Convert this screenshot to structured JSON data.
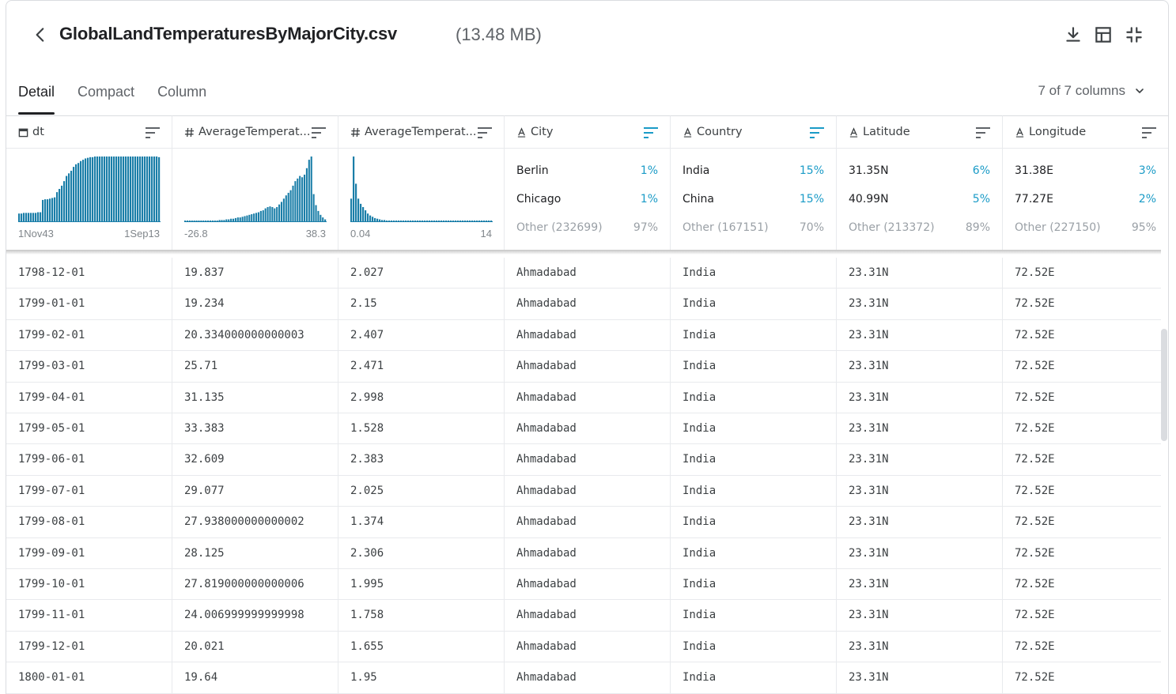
{
  "header": {
    "title": "GlobalLandTemperaturesByMajorCity.csv",
    "size": "(13.48 MB)",
    "icons": [
      "back-arrow-icon",
      "download-icon",
      "table-view-icon",
      "collapse-icon"
    ]
  },
  "tabs": [
    {
      "label": "Detail",
      "active": true
    },
    {
      "label": "Compact",
      "active": false
    },
    {
      "label": "Column",
      "active": false
    }
  ],
  "column_count": "7 of 7 columns",
  "columns": [
    {
      "type_icon": "calendar-icon",
      "type_glyph": "",
      "name": "dt"
    },
    {
      "type_icon": "numeric-icon",
      "type_glyph": "#",
      "name": "AverageTemperat..."
    },
    {
      "type_icon": "numeric-icon",
      "type_glyph": "#",
      "name": "AverageTemperat..."
    },
    {
      "type_icon": "string-icon",
      "type_glyph": "A",
      "name": "City"
    },
    {
      "type_icon": "string-icon",
      "type_glyph": "A",
      "name": "Country"
    },
    {
      "type_icon": "string-icon",
      "type_glyph": "A",
      "name": "Latitude"
    },
    {
      "type_icon": "string-icon",
      "type_glyph": "A",
      "name": "Longitude"
    }
  ],
  "histograms": [
    {
      "min": "1Nov43",
      "max": "1Sep13",
      "color": "#1a7ea8",
      "bars": [
        0.12,
        0.12,
        0.13,
        0.13,
        0.13,
        0.13,
        0.13,
        0.13,
        0.14,
        0.14,
        0.33,
        0.34,
        0.34,
        0.35,
        0.36,
        0.37,
        0.45,
        0.5,
        0.55,
        0.62,
        0.7,
        0.74,
        0.78,
        0.84,
        0.88,
        0.9,
        0.93,
        0.95,
        0.97,
        0.98,
        0.99,
        0.99,
        1.0,
        1.0,
        1.0,
        1.0,
        1.0,
        1.0,
        1.0,
        1.0,
        1.0,
        1.0,
        1.0,
        1.0,
        1.0,
        1.0,
        1.0,
        1.0,
        1.0,
        1.0,
        1.0,
        1.0,
        1.0,
        1.0,
        1.0,
        1.0,
        1.0,
        1.0,
        1.0,
        0.99
      ]
    },
    {
      "min": "-26.8",
      "max": "38.3",
      "color": "#1a7ea8",
      "bars": [
        0.01,
        0.01,
        0.01,
        0.01,
        0.01,
        0.01,
        0.01,
        0.01,
        0.01,
        0.01,
        0.01,
        0.01,
        0.01,
        0.01,
        0.01,
        0.02,
        0.02,
        0.02,
        0.03,
        0.03,
        0.04,
        0.04,
        0.05,
        0.06,
        0.06,
        0.07,
        0.08,
        0.09,
        0.1,
        0.11,
        0.12,
        0.13,
        0.14,
        0.16,
        0.17,
        0.2,
        0.22,
        0.23,
        0.22,
        0.2,
        0.22,
        0.26,
        0.3,
        0.35,
        0.4,
        0.44,
        0.48,
        0.55,
        0.62,
        0.66,
        0.7,
        0.68,
        0.72,
        0.82,
        0.95,
        1.0,
        0.42,
        0.25,
        0.16,
        0.1,
        0.06,
        0.03
      ]
    },
    {
      "min": "0.04",
      "max": "14",
      "color": "#1a7ea8",
      "bars": [
        0.35,
        1.0,
        0.58,
        0.35,
        0.27,
        0.22,
        0.17,
        0.12,
        0.09,
        0.07,
        0.05,
        0.04,
        0.03,
        0.02,
        0.02,
        0.01,
        0.01,
        0.01,
        0.01,
        0.01,
        0.01,
        0.01,
        0.01,
        0.01,
        0.01,
        0.01,
        0.01,
        0.01,
        0.01,
        0.01,
        0.01,
        0.01,
        0.01,
        0.01,
        0.01,
        0.01,
        0.01,
        0.01,
        0.01,
        0.01,
        0.01,
        0.01,
        0.01,
        0.01,
        0.01,
        0.01,
        0.01,
        0.01,
        0.01,
        0.01,
        0.01,
        0.01,
        0.01,
        0.01,
        0.01,
        0.01,
        0.01,
        0.01,
        0.01,
        0.01
      ]
    }
  ],
  "freq": [
    {
      "rows": [
        {
          "label": "Berlin",
          "pct": "1%"
        },
        {
          "label": "Chicago",
          "pct": "1%"
        },
        {
          "label": "Other (232699)",
          "pct": "97%"
        }
      ]
    },
    {
      "rows": [
        {
          "label": "India",
          "pct": "15%"
        },
        {
          "label": "China",
          "pct": "15%"
        },
        {
          "label": "Other (167151)",
          "pct": "70%"
        }
      ]
    },
    {
      "rows": [
        {
          "label": "31.35N",
          "pct": "6%"
        },
        {
          "label": "40.99N",
          "pct": "5%"
        },
        {
          "label": "Other (213372)",
          "pct": "89%"
        }
      ]
    },
    {
      "rows": [
        {
          "label": "31.38E",
          "pct": "3%"
        },
        {
          "label": "77.27E",
          "pct": "2%"
        },
        {
          "label": "Other (227150)",
          "pct": "95%"
        }
      ]
    }
  ],
  "rows": [
    [
      "1798-12-01",
      "19.837",
      "2.027",
      "Ahmadabad",
      "India",
      "23.31N",
      "72.52E"
    ],
    [
      "1799-01-01",
      "19.234",
      "2.15",
      "Ahmadabad",
      "India",
      "23.31N",
      "72.52E"
    ],
    [
      "1799-02-01",
      "20.334000000000003",
      "2.407",
      "Ahmadabad",
      "India",
      "23.31N",
      "72.52E"
    ],
    [
      "1799-03-01",
      "25.71",
      "2.471",
      "Ahmadabad",
      "India",
      "23.31N",
      "72.52E"
    ],
    [
      "1799-04-01",
      "31.135",
      "2.998",
      "Ahmadabad",
      "India",
      "23.31N",
      "72.52E"
    ],
    [
      "1799-05-01",
      "33.383",
      "1.528",
      "Ahmadabad",
      "India",
      "23.31N",
      "72.52E"
    ],
    [
      "1799-06-01",
      "32.609",
      "2.383",
      "Ahmadabad",
      "India",
      "23.31N",
      "72.52E"
    ],
    [
      "1799-07-01",
      "29.077",
      "2.025",
      "Ahmadabad",
      "India",
      "23.31N",
      "72.52E"
    ],
    [
      "1799-08-01",
      "27.938000000000002",
      "1.374",
      "Ahmadabad",
      "India",
      "23.31N",
      "72.52E"
    ],
    [
      "1799-09-01",
      "28.125",
      "2.306",
      "Ahmadabad",
      "India",
      "23.31N",
      "72.52E"
    ],
    [
      "1799-10-01",
      "27.819000000000006",
      "1.995",
      "Ahmadabad",
      "India",
      "23.31N",
      "72.52E"
    ],
    [
      "1799-11-01",
      "24.006999999999998",
      "1.758",
      "Ahmadabad",
      "India",
      "23.31N",
      "72.52E"
    ],
    [
      "1799-12-01",
      "20.021",
      "1.655",
      "Ahmadabad",
      "India",
      "23.31N",
      "72.52E"
    ],
    [
      "1800-01-01",
      "19.64",
      "1.95",
      "Ahmadabad",
      "India",
      "23.31N",
      "72.52E"
    ]
  ]
}
